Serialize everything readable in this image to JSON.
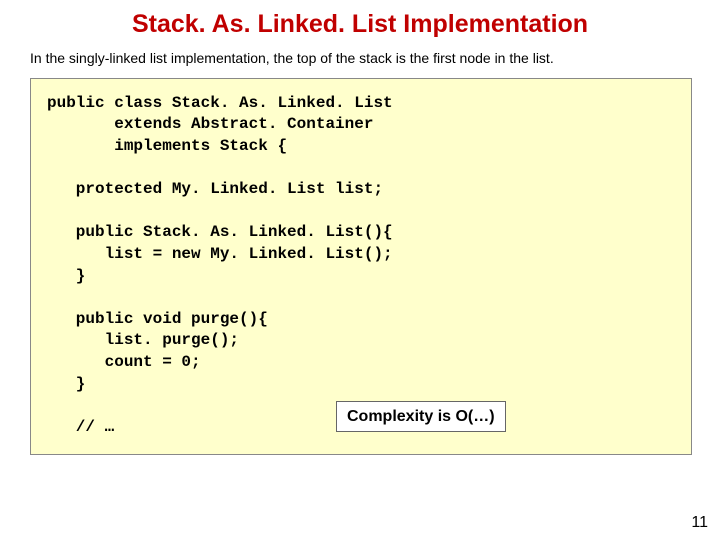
{
  "title": "Stack. As. Linked. List Implementation",
  "intro": "In the singly-linked list implementation, the top of the stack is the first node in the list.",
  "code": "public class Stack. As. Linked. List\n       extends Abstract. Container\n       implements Stack {\n\n   protected My. Linked. List list;\n\n   public Stack. As. Linked. List(){\n      list = new My. Linked. List();\n   }\n\n   public void purge(){\n      list. purge();\n      count = 0;\n   }\n\n   // …",
  "callout": "Complexity is O(…)",
  "page_number": "11"
}
